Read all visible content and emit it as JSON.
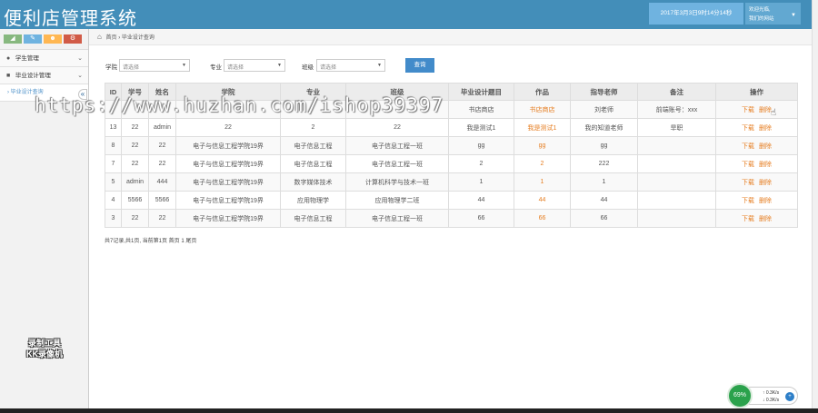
{
  "header": {
    "title": "便利店管理系统",
    "datetime": "2017年3月3日9时14分14秒",
    "user_line1": "欢迎光临,",
    "user_line2": "我们的网站"
  },
  "sidebar": {
    "items": [
      {
        "label": "学生管理"
      },
      {
        "label": "毕业设计管理"
      }
    ],
    "sub_items": [
      {
        "label": "毕业设计查询"
      }
    ]
  },
  "breadcrumb": {
    "home": "首页",
    "current": "毕业设计查询"
  },
  "filters": {
    "college_label": "学院",
    "major_label": "专业",
    "class_label": "班级",
    "placeholder": "请选择",
    "query_button": "查询"
  },
  "table": {
    "headers": [
      "ID",
      "学号",
      "姓名",
      "学院",
      "专业",
      "班级",
      "毕业设计题目",
      "作品",
      "指导老师",
      "备注",
      "操作"
    ],
    "rows": [
      {
        "id": "",
        "sno": "",
        "name": "",
        "college": "",
        "major": "",
        "cls": "",
        "topic": "书店商店",
        "work": "书店商店",
        "teacher": "刘老师",
        "remark": "前端账号：xxx"
      },
      {
        "id": "13",
        "sno": "22",
        "name": "admin",
        "college": "22",
        "major": "2",
        "cls": "22",
        "topic": "我是测试1",
        "work": "我是测试1",
        "teacher": "我的知道老师",
        "remark": "旱职"
      },
      {
        "id": "8",
        "sno": "22",
        "name": "22",
        "college": "电子与信息工程学院19界",
        "major": "电子信息工程",
        "cls": "电子信息工程一班",
        "topic": "gg",
        "work": "gg",
        "teacher": "gg",
        "remark": ""
      },
      {
        "id": "7",
        "sno": "22",
        "name": "22",
        "college": "电子与信息工程学院19界",
        "major": "电子信息工程",
        "cls": "电子信息工程一班",
        "topic": "2",
        "work": "2",
        "teacher": "222",
        "remark": ""
      },
      {
        "id": "5",
        "sno": "admin",
        "name": "444",
        "college": "电子与信息工程学院19界",
        "major": "数字媒体技术",
        "cls": "计算机科学与技术一班",
        "topic": "1",
        "work": "1",
        "teacher": "1",
        "remark": ""
      },
      {
        "id": "4",
        "sno": "5566",
        "name": "5566",
        "college": "电子与信息工程学院19界",
        "major": "应用物理学",
        "cls": "应用物理学二班",
        "topic": "44",
        "work": "44",
        "teacher": "44",
        "remark": ""
      },
      {
        "id": "3",
        "sno": "22",
        "name": "22",
        "college": "电子与信息工程学院19界",
        "major": "电子信息工程",
        "cls": "电子信息工程一班",
        "topic": "66",
        "work": "66",
        "teacher": "66",
        "remark": ""
      }
    ],
    "download_label": "下载",
    "delete_label": "删除"
  },
  "pager": {
    "text": "共7记录,共1页, 当前第1页 首页 1 尾页"
  },
  "overlay": {
    "watermark": "https://www.huzhan.com/ishop39397",
    "recorder_line1": "录制工具",
    "recorder_line2": "KK录像机"
  },
  "tray": {
    "percent": "69%",
    "up": "0.3K/s",
    "down": "0.3K/s"
  },
  "colors": {
    "header": "#438eb9",
    "link": "#e67e22",
    "button": "#428bca"
  }
}
